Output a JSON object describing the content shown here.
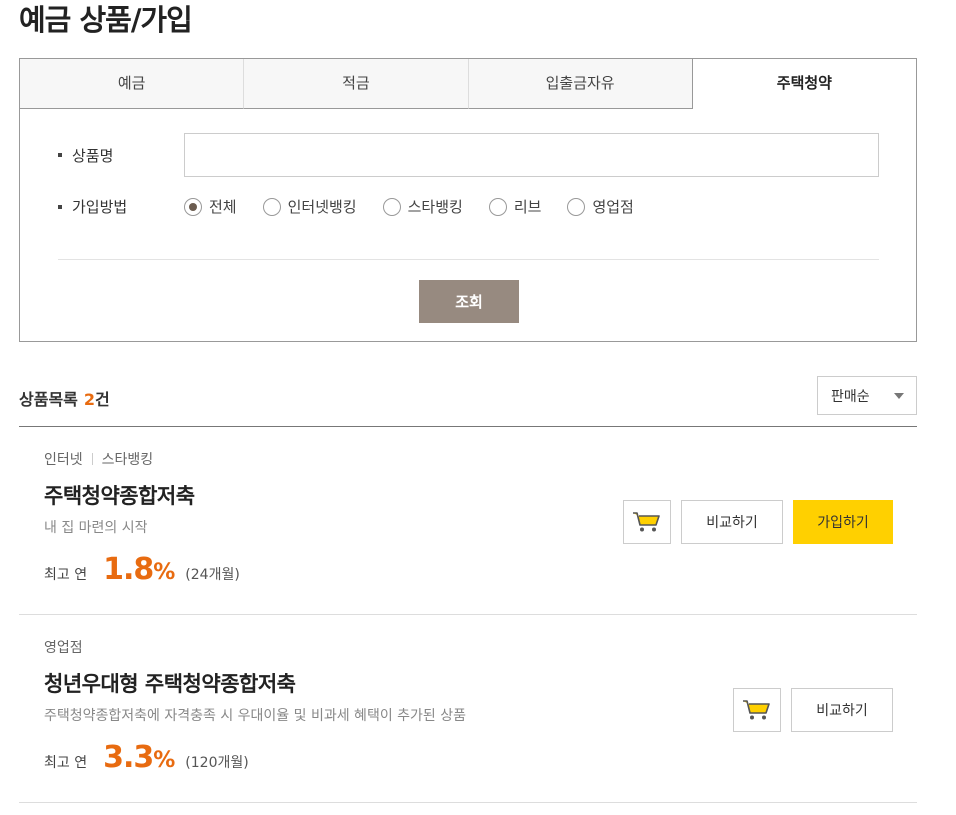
{
  "page_title": "예금 상품/가입",
  "tabs": [
    {
      "label": "예금"
    },
    {
      "label": "적금"
    },
    {
      "label": "입출금자유"
    },
    {
      "label": "주택청약"
    }
  ],
  "search": {
    "name_label": "상품명",
    "name_value": "",
    "method_label": "가입방법",
    "methods": [
      {
        "label": "전체",
        "checked": true
      },
      {
        "label": "인터넷뱅킹",
        "checked": false
      },
      {
        "label": "스타뱅킹",
        "checked": false
      },
      {
        "label": "리브",
        "checked": false
      },
      {
        "label": "영업점",
        "checked": false
      }
    ],
    "submit_label": "조회"
  },
  "list": {
    "title": "상품목록",
    "count": "2",
    "count_unit": "건",
    "sort_label": "판매순"
  },
  "products": [
    {
      "channels": [
        "인터넷",
        "스타뱅킹"
      ],
      "name": "주택청약종합저축",
      "desc": "내 집 마련의 시작",
      "rate_prefix": "최고 연",
      "rate": "1.8",
      "rate_unit": "%",
      "term": "(24개월)",
      "compare_label": "비교하기",
      "join_label": "가입하기"
    },
    {
      "channels": [
        "영업점"
      ],
      "name": "청년우대형 주택청약종합저축",
      "desc": "주택청약종합저축에 자격충족 시 우대이율 및 비과세 혜택이 추가된 상품",
      "rate_prefix": "최고 연",
      "rate": "3.3",
      "rate_unit": "%",
      "term": "(120개월)",
      "compare_label": "비교하기"
    }
  ],
  "colors": {
    "accent": "#e86b10",
    "join_button": "#ffd000",
    "search_button": "#978a80",
    "cart_icon": "#ffd000"
  }
}
